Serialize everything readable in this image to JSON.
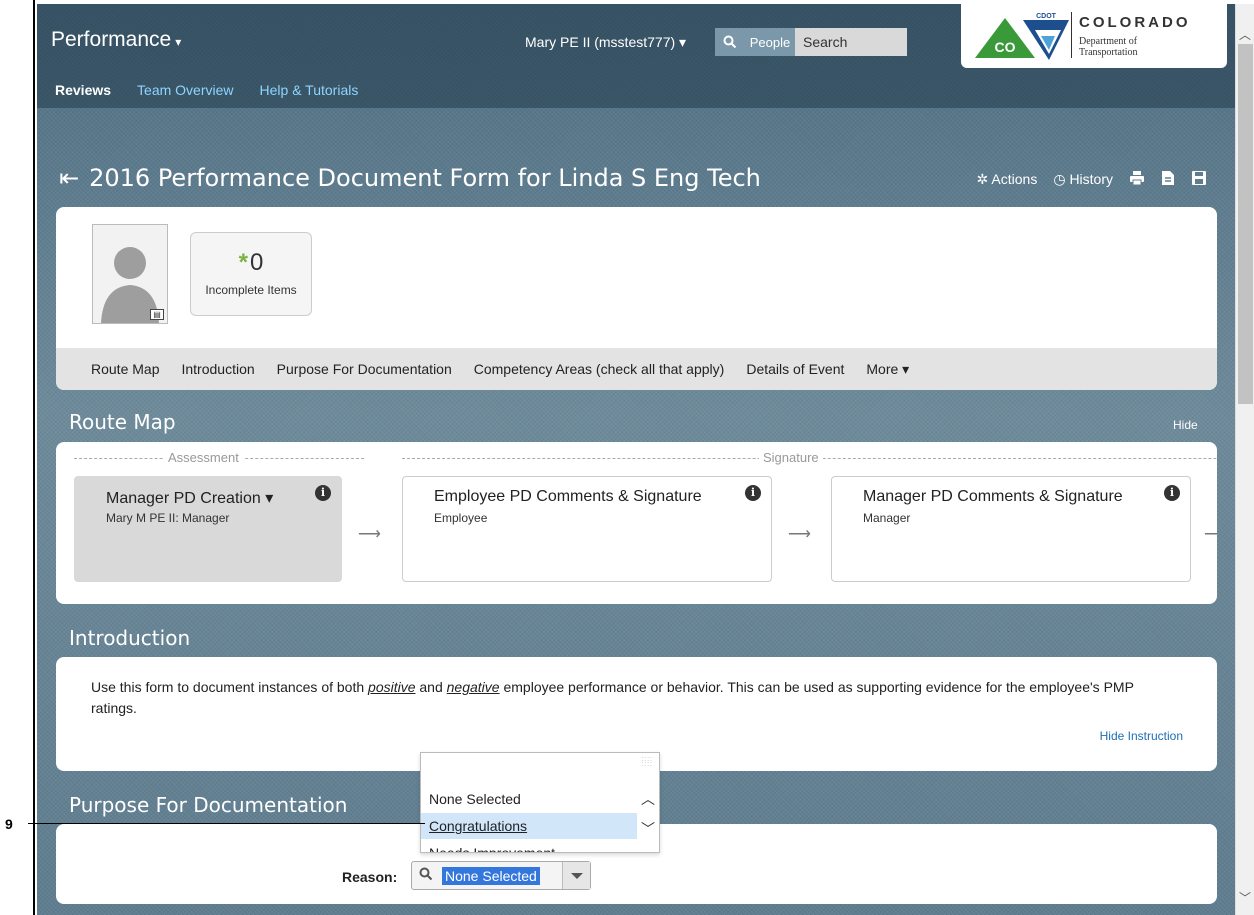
{
  "header": {
    "app_title": "Performance",
    "app_caret": "▾",
    "user_menu": "Mary PE II (msstest777) ▾",
    "people_label": "People",
    "search_placeholder": "Search",
    "logo": {
      "badge": "CDOT",
      "state": "COLORADO",
      "dept_line1": "Department of",
      "dept_line2": "Transportation",
      "co_letters": "CO"
    }
  },
  "subnav": {
    "items": [
      "Reviews",
      "Team Overview",
      "Help & Tutorials"
    ],
    "active": "Reviews"
  },
  "document": {
    "title": "2016 Performance Document Form for Linda S Eng Tech",
    "actions_label": "Actions",
    "history_label": "History"
  },
  "profile": {
    "incomplete_count": "0",
    "incomplete_label": "Incomplete Items"
  },
  "section_nav": {
    "items": [
      "Route Map",
      "Introduction",
      "Purpose For Documentation",
      "Competency Areas (check all that apply)",
      "Details of Event"
    ],
    "more_label": "More ▾"
  },
  "route_map": {
    "title": "Route Map",
    "hide_label": "Hide",
    "phases": {
      "assessment": "Assessment",
      "signature": "Signature"
    },
    "steps": [
      {
        "title": "Manager PD Creation ▾",
        "subtitle": "Mary M PE II: Manager"
      },
      {
        "title": "Employee PD Comments & Signature",
        "subtitle": "Employee"
      },
      {
        "title": "Manager PD Comments & Signature",
        "subtitle": "Manager"
      }
    ]
  },
  "introduction": {
    "title": "Introduction",
    "text_part1": "Use this form to document instances of both ",
    "positive": "positive",
    "text_and": " and ",
    "negative": "negative",
    "text_part2": " employee performance or behavior. This can be used as supporting evidence for the employee's PMP ratings.",
    "hide_instruction": "Hide Instruction"
  },
  "purpose": {
    "title": "Purpose For Documentation",
    "reason_label": "Reason:",
    "reason_value": "None Selected",
    "options": [
      "None Selected",
      "Congratulations",
      "Needs Improvement"
    ],
    "highlighted_option": "Congratulations"
  },
  "annotation": {
    "callout_number": "9"
  },
  "colors": {
    "link": "#8fd4ff",
    "accent_green": "#7cb342",
    "highlight": "#d2e6fa"
  }
}
